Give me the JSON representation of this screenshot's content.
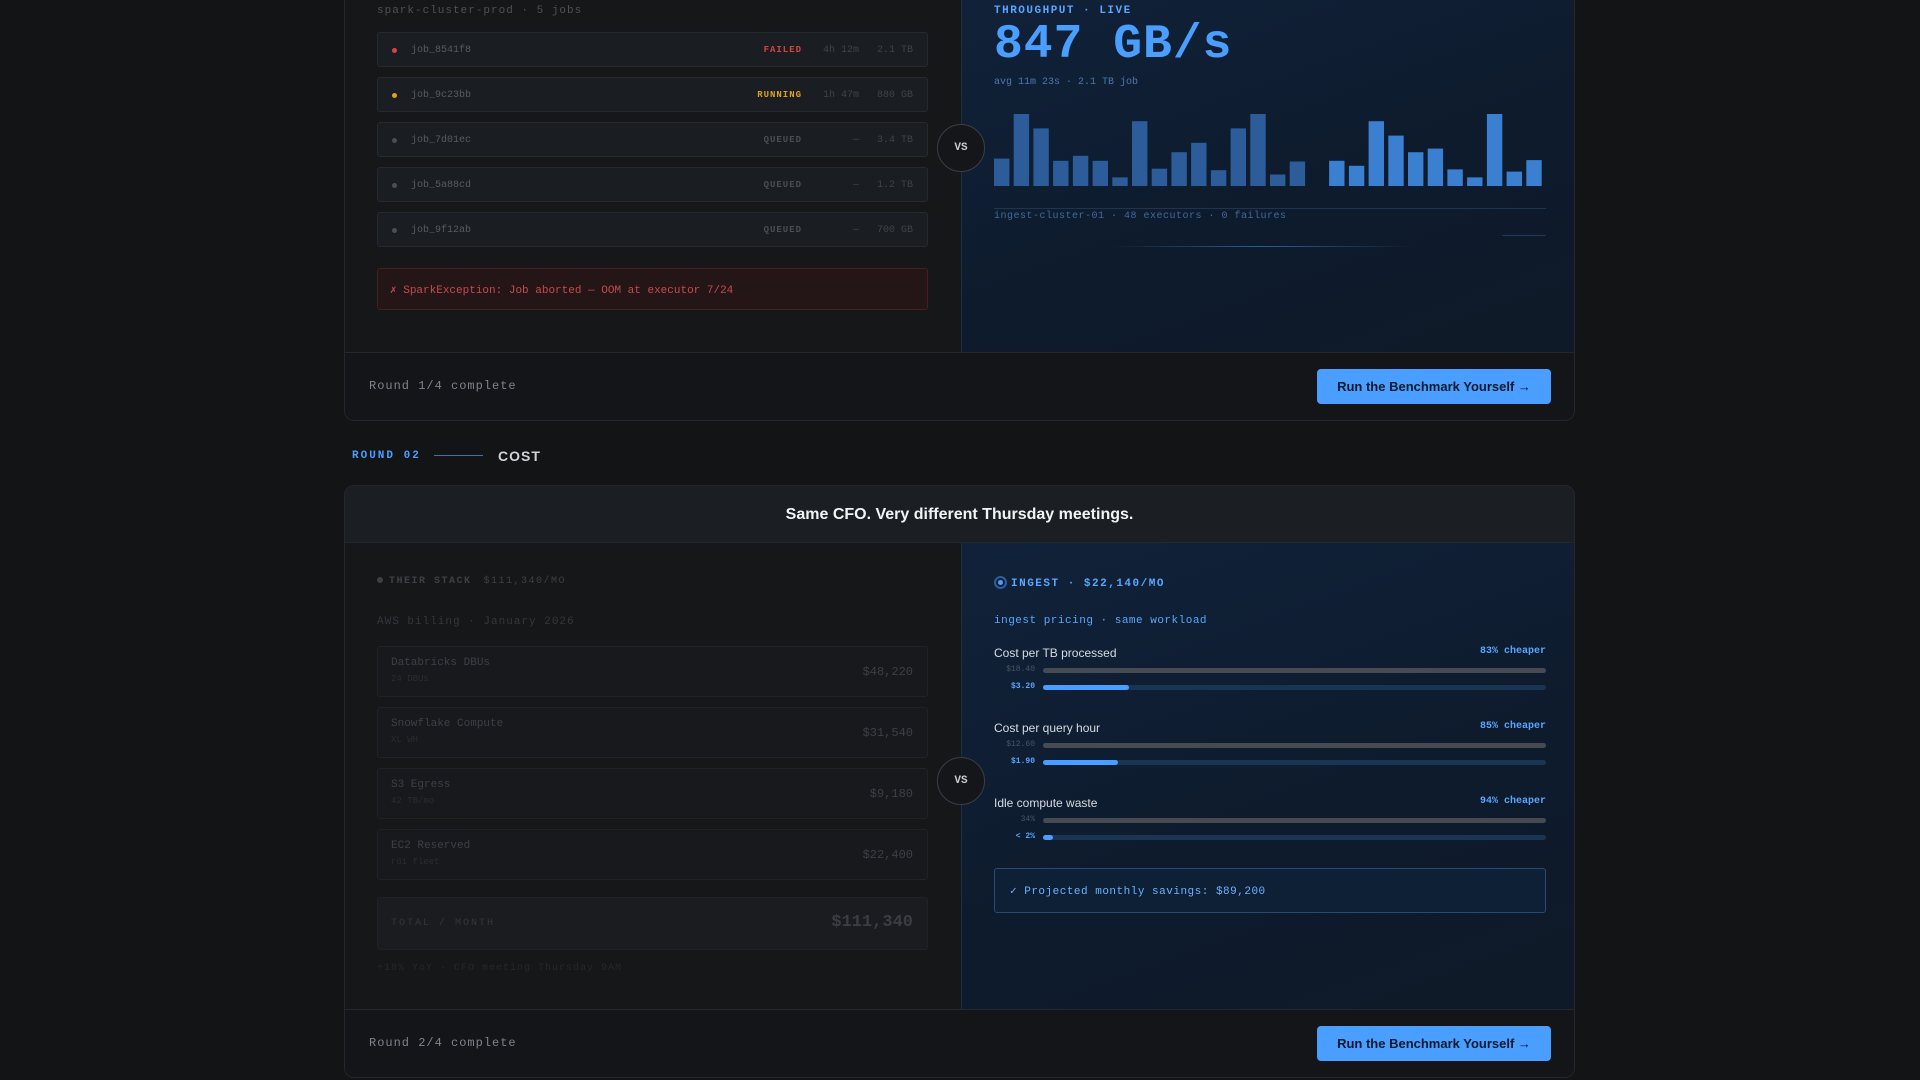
{
  "round1": {
    "left": {
      "cluster_header": "spark-cluster-prod · 5 jobs",
      "jobs": [
        {
          "name": "job_8541f8",
          "status": "FAILED",
          "time": "4h 12m",
          "size": "2.1 TB",
          "color": "#d64545"
        },
        {
          "name": "job_9c23bb",
          "status": "RUNNING",
          "time": "1h 47m",
          "size": "880 GB",
          "color": "#e0a020"
        },
        {
          "name": "job_7d01ec",
          "status": "QUEUED",
          "time": "—",
          "size": "3.4 TB",
          "color": "#4a4f55"
        },
        {
          "name": "job_5a88cd",
          "status": "QUEUED",
          "time": "—",
          "size": "1.2 TB",
          "color": "#4a4f55"
        },
        {
          "name": "job_9f12ab",
          "status": "QUEUED",
          "time": "—",
          "size": "700 GB",
          "color": "#4a4f55"
        }
      ],
      "error": "✗ SparkException: Job aborted — OOM at executor 7/24"
    },
    "right": {
      "label": "THROUGHPUT · LIVE",
      "value": "847 GB/s",
      "sub": "avg 11m 23s · 2.1 TB job",
      "footer": "ingest-cluster-01 · 48 executors · 0 failures"
    },
    "bar_levels": [
      0.38,
      1.0,
      0.8,
      0.35,
      0.42,
      0.35,
      0.12,
      0.9,
      0.24,
      0.47,
      0.6,
      0.22,
      0.8,
      1.0,
      0.16,
      0.34,
      0,
      0.35,
      0.28,
      0.9,
      0.7,
      0.47,
      0.52,
      0.23,
      0.12,
      1.0,
      0.2,
      0.36
    ],
    "vs": "VS",
    "footer_status": "Round 1/4 complete",
    "cta": "Run the Benchmark Yourself →"
  },
  "round2": {
    "number": "ROUND 02",
    "name": "COST",
    "headline": "Same CFO. Very different Thursday meetings.",
    "left": {
      "header_label": "THEIR STACK",
      "header_amount": "$111,340/MO",
      "billing": "AWS billing · January 2026",
      "items": [
        {
          "name": "Databricks DBUs",
          "sub": "24 DBUs",
          "amount": "$48,220"
        },
        {
          "name": "Snowflake Compute",
          "sub": "XL WH",
          "amount": "$31,540"
        },
        {
          "name": "S3 Egress",
          "sub": "42 TB/mo",
          "amount": "$9,180"
        },
        {
          "name": "EC2 Reserved",
          "sub": "r6i fleet",
          "amount": "$22,400"
        }
      ],
      "total_label": "TOTAL / MONTH",
      "total_amount": "$111,340",
      "footer": "+18% YoY · CFO meeting Thursday 9AM"
    },
    "right": {
      "header": "INGEST · $22,140/MO",
      "sub": "ingest pricing · same workload",
      "metrics": [
        {
          "title": "Cost per TB processed",
          "pct": "83% cheaper",
          "their_label": "$18.40",
          "ing_label": "$3.20",
          "their_level": 1.0,
          "ing_level": 0.17
        },
        {
          "title": "Cost per query hour",
          "pct": "85% cheaper",
          "their_label": "$12.60",
          "ing_label": "$1.90",
          "their_level": 1.0,
          "ing_level": 0.15
        },
        {
          "title": "Idle compute waste",
          "pct": "94% cheaper",
          "their_label": "34%",
          "ing_label": "< 2%",
          "their_level": 1.0,
          "ing_level": 0.02
        }
      ],
      "savings": "✓ Projected monthly savings: $89,200"
    },
    "vs": "VS",
    "footer_status": "Round 2/4 complete",
    "cta": "Run the Benchmark Yourself →"
  }
}
